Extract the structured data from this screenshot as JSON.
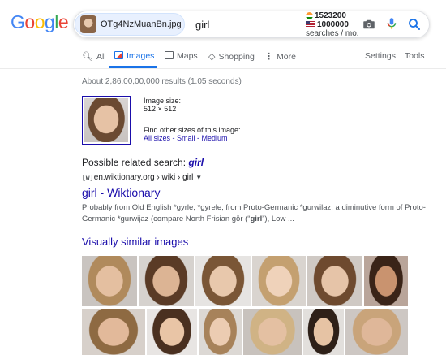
{
  "header": {
    "logo_letters": [
      {
        "ch": "G",
        "color": "#4285f4"
      },
      {
        "ch": "o",
        "color": "#ea4335"
      },
      {
        "ch": "o",
        "color": "#fbbc05"
      },
      {
        "ch": "g",
        "color": "#4285f4"
      },
      {
        "ch": "l",
        "color": "#34a853"
      },
      {
        "ch": "e",
        "color": "#ea4335"
      }
    ],
    "image_chip_label": "OTg4NzMuanBn.jpg",
    "query": "girl",
    "searches": {
      "india_count": "1523200",
      "us_count": "1000000",
      "unit_label": "searches / mo."
    },
    "icons": [
      "camera-icon",
      "microphone-icon",
      "search-icon"
    ]
  },
  "tabs": {
    "all": "All",
    "images": "Images",
    "maps": "Maps",
    "shopping": "Shopping",
    "more": "More",
    "settings": "Settings",
    "tools": "Tools"
  },
  "results_count": "About 2,86,00,00,000 results (1.05 seconds)",
  "image_info": {
    "size_label": "Image size:",
    "size_value": "512 × 512",
    "other_sizes_label": "Find other sizes of this image:",
    "all_sizes": "All sizes",
    "separator": " - ",
    "small": "Small",
    "medium": "Medium"
  },
  "related": {
    "label": "Possible related search: ",
    "term": "girl"
  },
  "result": {
    "site_icon": "[w]",
    "site_url": "en.wiktionary.org › wiki › girl",
    "title": "girl - Wiktionary",
    "snippet_part1": "Probably from Old English *gyrle, *gyrele, from Proto-Germanic *gurwilaz, a diminutive form of Proto-Germanic *gurwijaz (compare North Frisian gör (“",
    "snippet_bold": "girl",
    "snippet_part2": "”), Low ..."
  },
  "similar": {
    "title": "Visually similar images"
  }
}
